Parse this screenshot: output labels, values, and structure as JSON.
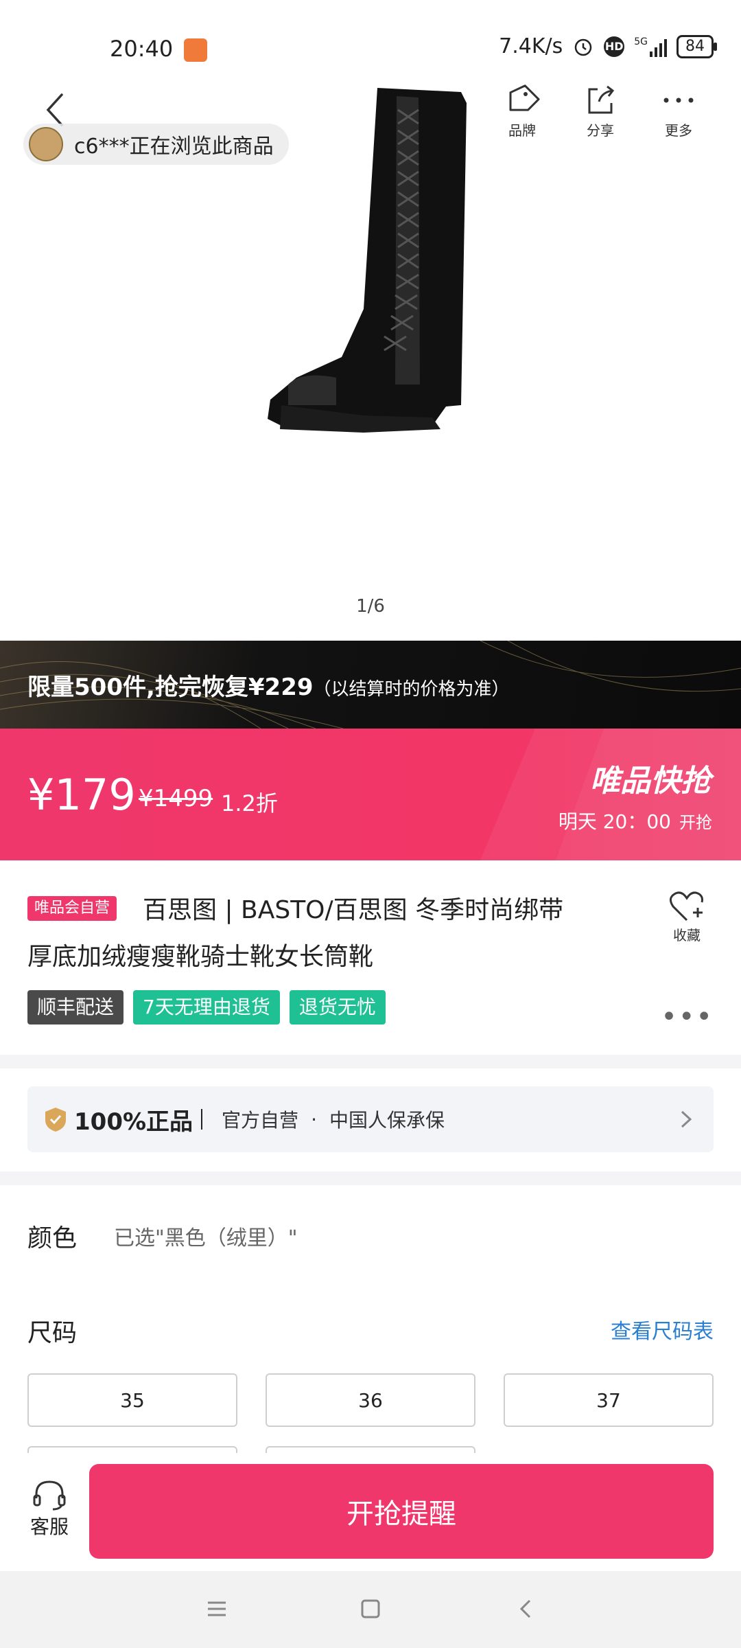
{
  "status_bar": {
    "time": "20:40",
    "network_speed": "7.4K/s",
    "hd_label": "HD",
    "signal_label": "5G",
    "battery": "84"
  },
  "overlay": {
    "browsing_text": "c6***正在浏览此商品",
    "actions": [
      {
        "label": "品牌",
        "icon": "tag-icon"
      },
      {
        "label": "分享",
        "icon": "share-icon"
      },
      {
        "label": "更多",
        "icon": "more-icon"
      }
    ]
  },
  "gallery": {
    "pager": "1/6"
  },
  "promo_banner": {
    "text": "限量500件,抢完恢复¥229",
    "note": "（以结算时的价格为准）"
  },
  "price_bar": {
    "price": "¥179",
    "original_price": "¥1499",
    "discount": "1.2折",
    "flash_title": "唯品快抢",
    "flash_day": "明天 20：00",
    "flash_suffix": "开抢"
  },
  "product": {
    "badge": "唯品会自营",
    "title_line1": "百思图 | BASTO/百思图 冬季时尚绑带",
    "title_line2": "厚底加绒瘦瘦靴骑士靴女长筒靴",
    "favorite_label": "收藏",
    "tags": [
      "顺丰配送",
      "7天无理由退货",
      "退货无忧"
    ],
    "more": "•••"
  },
  "guarantee": {
    "main": "100%正品",
    "items": [
      "官方自营",
      "中国人保承保"
    ],
    "separator": "·"
  },
  "color": {
    "label": "颜色",
    "value": "已选\"黑色（绒里）\""
  },
  "size": {
    "label": "尺码",
    "chart_link": "查看尺码表",
    "options": [
      "35",
      "36",
      "37"
    ]
  },
  "bottom_bar": {
    "service_label": "客服",
    "remind_button": "开抢提醒"
  },
  "colors": {
    "accent": "#f0376c",
    "green_tag": "#1fc194",
    "link": "#2a7fd1"
  }
}
